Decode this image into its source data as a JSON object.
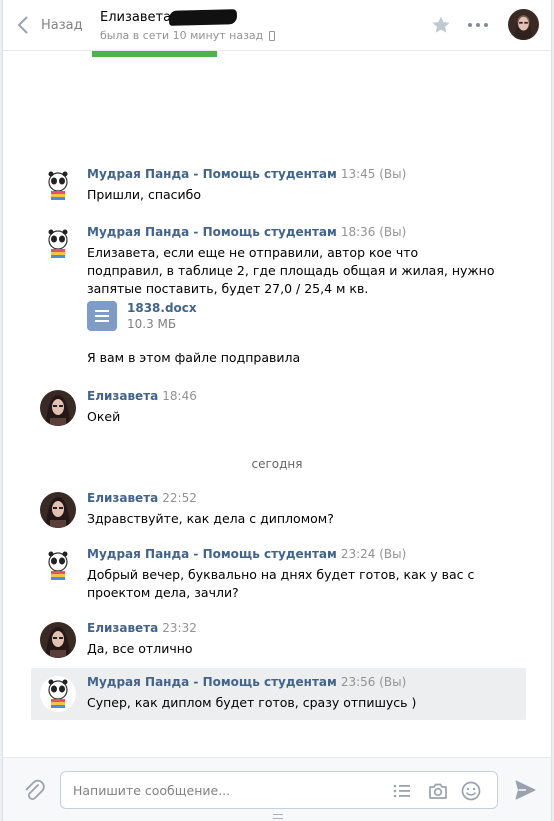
{
  "header": {
    "back_label": "Назад",
    "peer_name": "Елизавета",
    "peer_status": "была в сети 10 минут назад"
  },
  "messages": [
    {
      "author": "Мудрая Панда - Помощь студентам",
      "time": "13:45",
      "by_you": "(Вы)",
      "text": "Пришли, спасибо"
    },
    {
      "author": "Мудрая Панда - Помощь студентам",
      "time": "18:36",
      "by_you": "(Вы)",
      "text": "Елизавета, если еще не отправили, автор кое что подправил, в таблице 2, где площадь общая и жилая, нужно запятые поставить, будет 27,0 / 25,4 м кв.",
      "attachment": {
        "name": "1838.docx",
        "size": "10.3 МБ"
      },
      "followup": "Я вам в этом файле подправила"
    },
    {
      "author": "Елизавета",
      "time": "18:46",
      "text": "Окей"
    },
    {
      "author": "Елизавета",
      "time": "22:52",
      "text": "Здравствуйте, как дела с дипломом?"
    },
    {
      "author": "Мудрая Панда - Помощь студентам",
      "time": "23:24",
      "by_you": "(Вы)",
      "text": "Добрый вечер, буквально на днях будет готов, как у вас с проектом дела, зачли?"
    },
    {
      "author": "Елизавета",
      "time": "23:32",
      "text": "Да, все отлично"
    },
    {
      "author": "Мудрая Панда - Помощь студентам",
      "time": "23:56",
      "by_you": "(Вы)",
      "text": "Супер, как диплом будет готов, сразу отпишусь )"
    }
  ],
  "date_separator": "сегодня",
  "composer": {
    "placeholder": "Напишите сообщение..."
  },
  "icons": {
    "back": "chevron-left-icon",
    "favorite": "star-icon",
    "more": "more-dots-icon",
    "attach": "paperclip-icon",
    "templates": "list-icon",
    "camera": "camera-icon",
    "emoji": "emoji-icon",
    "send": "send-icon",
    "document": "document-icon"
  },
  "colors": {
    "accent": "#42648b",
    "highlight": "#edeef0",
    "doc_icon": "#7f9cc6",
    "green_strip": "#4bb34b"
  }
}
